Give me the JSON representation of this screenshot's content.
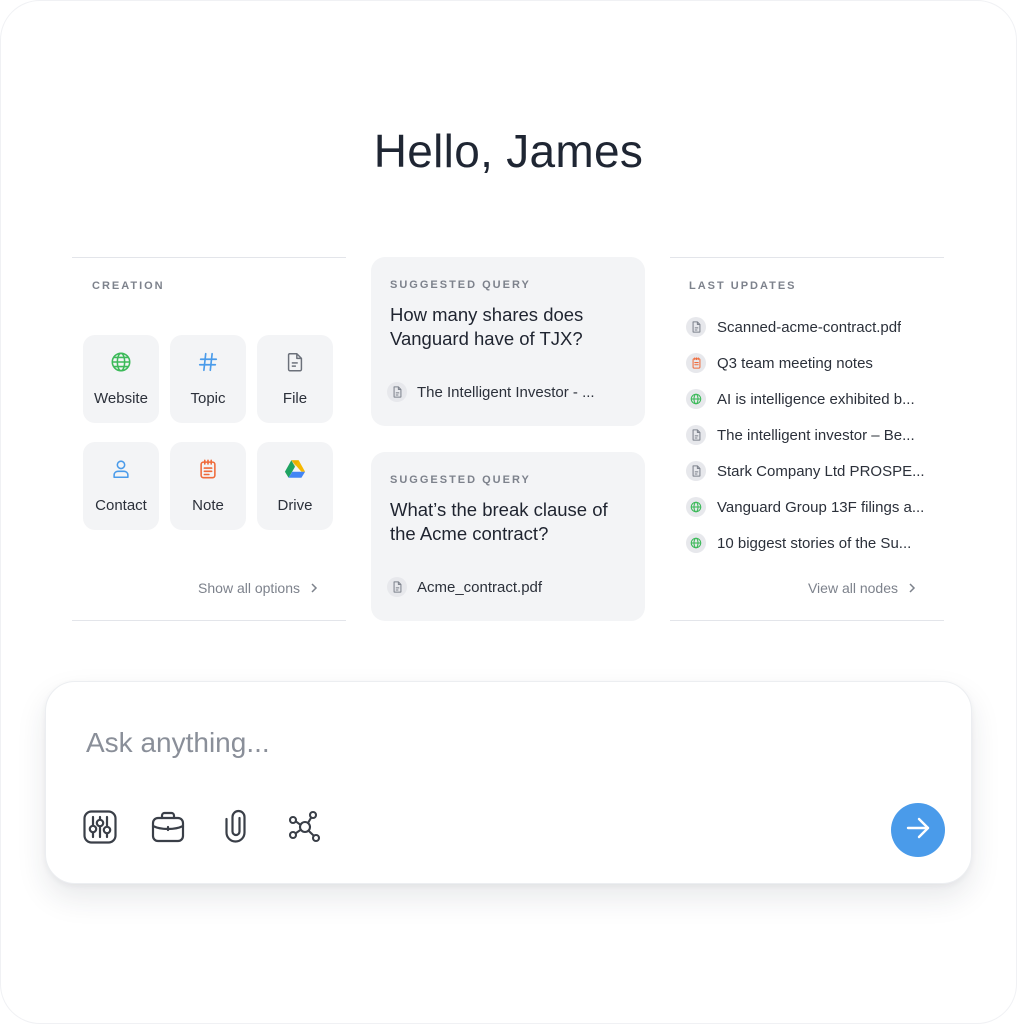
{
  "greeting": "Hello, James",
  "creation": {
    "label": "CREATION",
    "tiles": [
      {
        "label": "Website",
        "icon": "globe-icon"
      },
      {
        "label": "Topic",
        "icon": "hashtag-icon"
      },
      {
        "label": "File",
        "icon": "file-icon"
      },
      {
        "label": "Contact",
        "icon": "person-icon"
      },
      {
        "label": "Note",
        "icon": "note-icon"
      },
      {
        "label": "Drive",
        "icon": "google-drive-icon"
      }
    ],
    "show_all": "Show all options"
  },
  "suggestions": [
    {
      "label": "SUGGESTED QUERY",
      "text": "How many shares does Vanguard have of TJX?",
      "source": "The Intelligent Investor - ..."
    },
    {
      "label": "SUGGESTED QUERY",
      "text": "What’s the break clause of the Acme contract?",
      "source": "Acme_contract.pdf"
    }
  ],
  "updates": {
    "label": "LAST UPDATES",
    "items": [
      {
        "text": "Scanned-acme-contract.pdf",
        "icon": "file-icon"
      },
      {
        "text": "Q3 team meeting notes",
        "icon": "note-icon"
      },
      {
        "text": "AI is intelligence exhibited b...",
        "icon": "globe-icon"
      },
      {
        "text": "The intelligent investor – Be...",
        "icon": "file-icon"
      },
      {
        "text": "Stark Company Ltd PROSPE...",
        "icon": "file-icon"
      },
      {
        "text": "Vanguard Group 13F filings a...",
        "icon": "globe-icon"
      },
      {
        "text": "10 biggest stories of the Su...",
        "icon": "globe-icon"
      }
    ],
    "view_all": "View all nodes"
  },
  "ask": {
    "placeholder": "Ask anything...",
    "tools": [
      "filters-icon",
      "briefcase-icon",
      "paperclip-icon",
      "graph-nodes-icon"
    ],
    "send_icon": "arrow-right-icon"
  },
  "colors": {
    "accent": "#4a9bea",
    "globe": "#3dba5a",
    "hashtag": "#4a9bea",
    "note": "#ef6a3a",
    "tile_bg": "#f3f4f6"
  }
}
